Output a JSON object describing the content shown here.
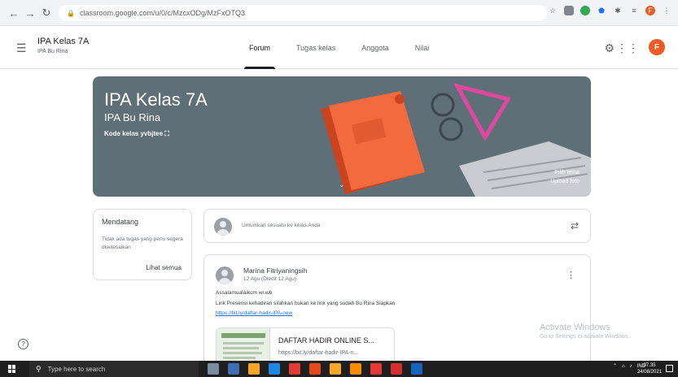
{
  "browser": {
    "url": "classroom.google.com/u/0/c/MzcxODg/MzFxOTQ3",
    "lock_icon": "lock-icon"
  },
  "header": {
    "class_title": "IPA Kelas 7A",
    "class_subtitle": "IPA Bu Rina",
    "avatar_letter": "F",
    "avatar_color": "#f05a24"
  },
  "tabs": [
    {
      "label": "Forum",
      "active": true
    },
    {
      "label": "Tugas kelas",
      "active": false
    },
    {
      "label": "Anggota",
      "active": false
    },
    {
      "label": "Nilai",
      "active": false
    }
  ],
  "banner": {
    "title": "IPA Kelas 7A",
    "subtitle": "IPA Bu Rina",
    "code_label": "Kode kelas",
    "code_value": "yvbjtee",
    "select_theme": "Pilih tema",
    "upload_photo": "Upload foto",
    "bg_color": "#5f6f78"
  },
  "upcoming": {
    "title": "Mendatang",
    "description": "Tidak ada tugas yang perlu segera diselesaikan",
    "view_all": "Lihat semua"
  },
  "announce": {
    "placeholder": "Umumkan sesuatu ke kelas Anda"
  },
  "post": {
    "author": "Marina Fitriyaningsih",
    "date": "12 Agu (Diedit 12 Agu)",
    "body_line1": "Assalamualaikum wr.wb",
    "body_line2": "Link Presensi kehadiran silahkan bukan ke link yang sudah Bu Rina Siapkan",
    "link": "https://bit.ly/daftar-hadir-IPA-new",
    "attachment_title": "DAFTAR HADIR ONLINE S...",
    "attachment_url": "https://bit.ly/daftar-hadir-IPA-n..."
  },
  "watermark": {
    "line1": "Activate Windows",
    "line2": "Go to Settings to activate Windows."
  },
  "taskbar": {
    "search_placeholder": "Type here to search",
    "time": "07.35",
    "date": "24/08/2021",
    "lang": "IND",
    "app_colors": [
      "#7a8ca0",
      "#3e6fb0",
      "#f6a623",
      "#1e88e5",
      "#e53935",
      "#e64a19",
      "#f9a825",
      "#fb8c00",
      "#e53935",
      "#d32f2f",
      "#1565c0"
    ]
  }
}
